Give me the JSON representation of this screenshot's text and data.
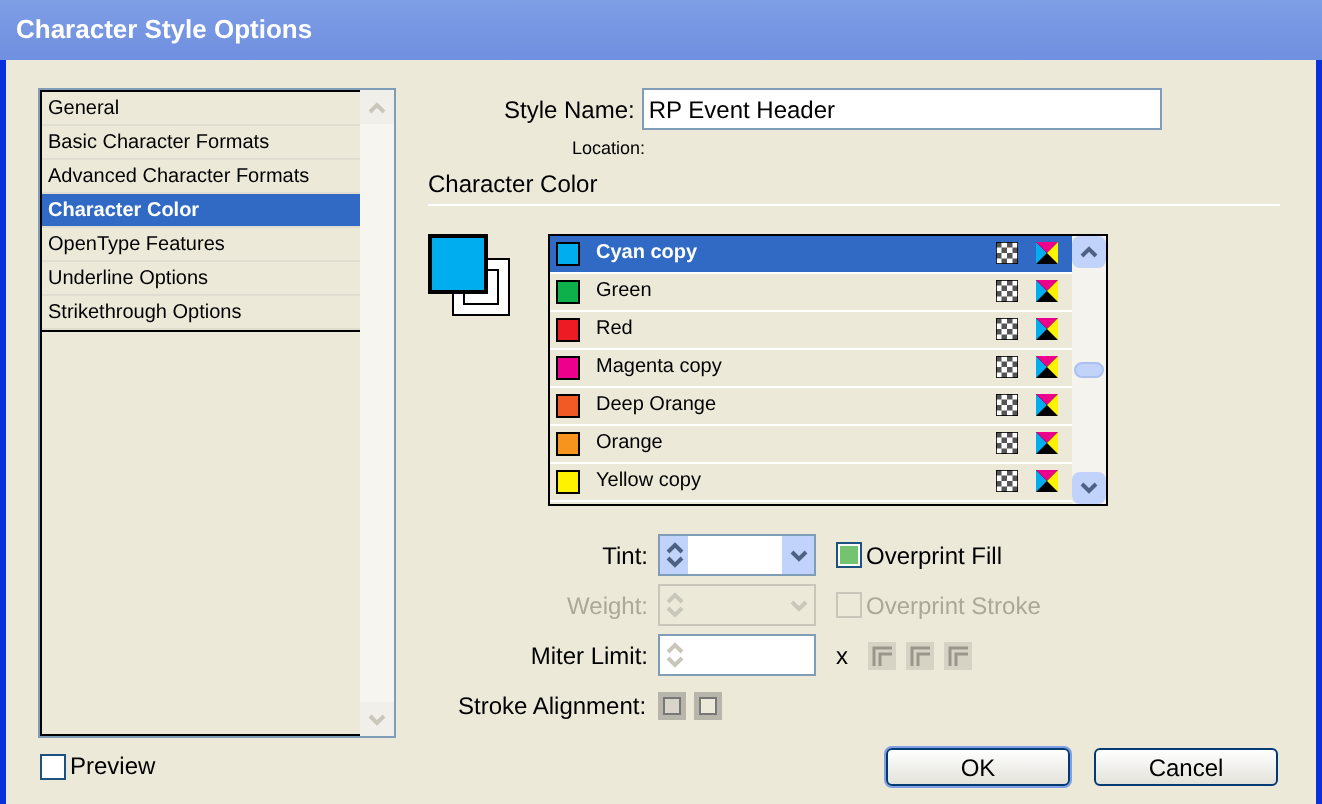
{
  "window": {
    "title": "Character Style Options"
  },
  "sidebar": {
    "items": [
      {
        "label": "General",
        "selected": false
      },
      {
        "label": "Basic Character Formats",
        "selected": false
      },
      {
        "label": "Advanced Character Formats",
        "selected": false
      },
      {
        "label": "Character Color",
        "selected": true
      },
      {
        "label": "OpenType Features",
        "selected": false
      },
      {
        "label": "Underline Options",
        "selected": false
      },
      {
        "label": "Strikethrough Options",
        "selected": false
      }
    ]
  },
  "style_name": {
    "label": "Style Name:",
    "value": "RP Event Header"
  },
  "location": {
    "label": "Location:"
  },
  "section_title": "Character Color",
  "preview_swatch": {
    "color": "#00aeef"
  },
  "swatches": [
    {
      "name": "Cyan copy",
      "color": "#00aeef",
      "selected": true
    },
    {
      "name": "Green",
      "color": "#0db04b",
      "selected": false
    },
    {
      "name": "Red",
      "color": "#ed1c24",
      "selected": false
    },
    {
      "name": "Magenta copy",
      "color": "#ec008c",
      "selected": false
    },
    {
      "name": "Deep Orange",
      "color": "#f15a24",
      "selected": false
    },
    {
      "name": "Orange",
      "color": "#f7941d",
      "selected": false
    },
    {
      "name": "Yellow copy",
      "color": "#fff200",
      "selected": false
    }
  ],
  "fields": [
    {
      "kind": "combo",
      "label": "Tint:",
      "disabled": false,
      "checkbox": {
        "label": "Overprint Fill",
        "checked": true,
        "disabled": false
      }
    },
    {
      "kind": "combo",
      "label": "Weight:",
      "disabled": true,
      "checkbox": {
        "label": "Overprint Stroke",
        "checked": false,
        "disabled": true
      }
    },
    {
      "kind": "spinner",
      "label": "Miter Limit:",
      "disabled": false,
      "suffix": "x"
    }
  ],
  "stroke_alignment": {
    "label": "Stroke Alignment:"
  },
  "preview": {
    "label": "Preview",
    "checked": false
  },
  "buttons": [
    "OK",
    "Cancel"
  ]
}
